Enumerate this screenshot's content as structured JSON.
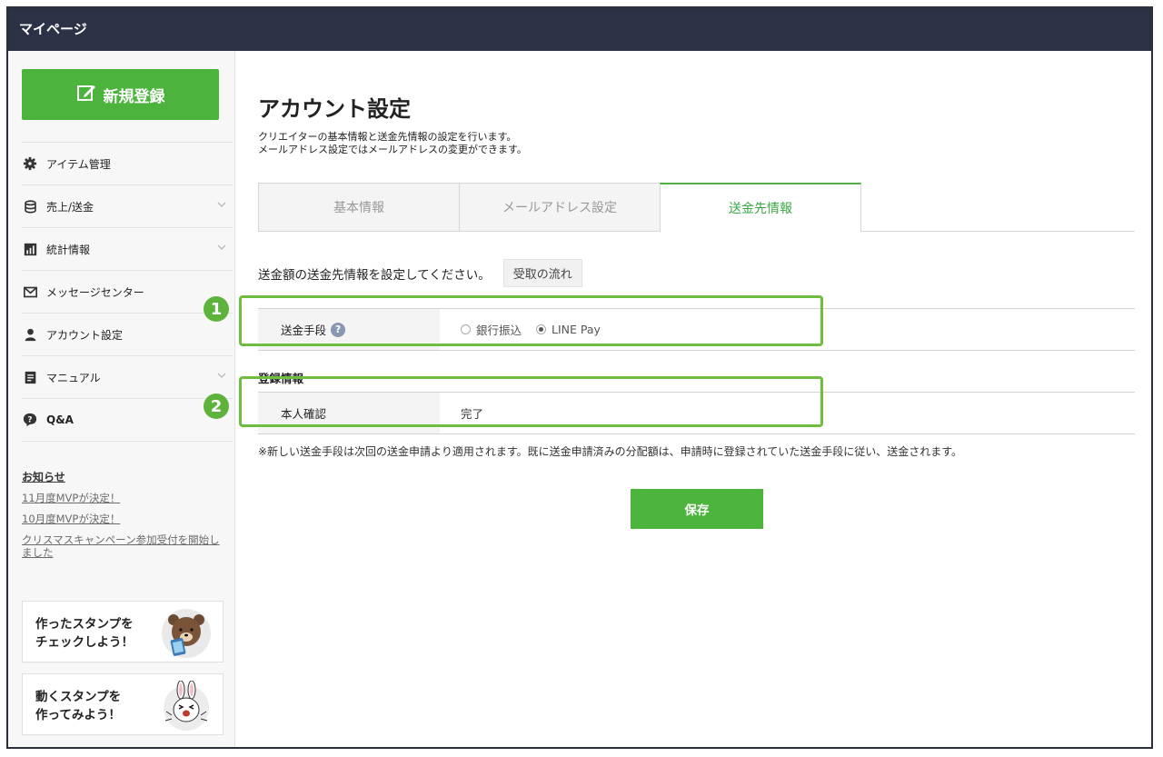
{
  "app": {
    "title": "マイページ"
  },
  "sidebar": {
    "new_button": "新規登録",
    "items": [
      {
        "label": "アイテム管理",
        "icon": "gear-icon",
        "has_chevron": false
      },
      {
        "label": "売上/送金",
        "icon": "database-icon",
        "has_chevron": true
      },
      {
        "label": "統計情報",
        "icon": "bar-chart-icon",
        "has_chevron": true
      },
      {
        "label": "メッセージセンター",
        "icon": "envelope-icon",
        "has_chevron": false
      },
      {
        "label": "アカウント設定",
        "icon": "person-icon",
        "has_chevron": false
      },
      {
        "label": "マニュアル",
        "icon": "document-icon",
        "has_chevron": true
      },
      {
        "label": "Q&A",
        "icon": "question-bubble-icon",
        "has_chevron": false
      }
    ],
    "news": {
      "title": "お知らせ",
      "links": [
        "11月度MVPが決定！",
        "10月度MVPが決定！",
        "クリスマスキャンペーン参加受付を開始しました"
      ]
    },
    "banners": [
      {
        "line1": "作ったスタンプを",
        "line2": "チェックしよう！",
        "image": "bear-character"
      },
      {
        "line1": "動くスタンプを",
        "line2": "作ってみよう！",
        "image": "rabbit-character"
      }
    ]
  },
  "main": {
    "title": "アカウント設定",
    "description_line1": "クリエイターの基本情報と送金先情報の設定を行います。",
    "description_line2": "メールアドレス設定ではメールアドレスの変更ができます。",
    "tabs": [
      {
        "label": "基本情報",
        "active": false
      },
      {
        "label": "メールアドレス設定",
        "active": false
      },
      {
        "label": "送金先情報",
        "active": true
      }
    ],
    "instruction": "送金額の送金先情報を設定してください。",
    "flow_button": "受取の流れ",
    "method_row": {
      "label": "送金手段",
      "options": [
        {
          "label": "銀行振込",
          "selected": false
        },
        {
          "label": "LINE Pay",
          "selected": true
        }
      ]
    },
    "registration_heading": "登録情報",
    "identity_row": {
      "label": "本人確認",
      "value": "完了"
    },
    "note": "※新しい送金手段は次回の送金申請より適用されます。既に送金申請済みの分配額は、申請時に登録されていた送金手段に従い、送金されます。",
    "save_button": "保存"
  },
  "callouts": [
    "1",
    "2"
  ],
  "colors": {
    "topbar": "#2b3246",
    "accent_green": "#4cb43c",
    "callout_green": "#6fbd3e"
  }
}
